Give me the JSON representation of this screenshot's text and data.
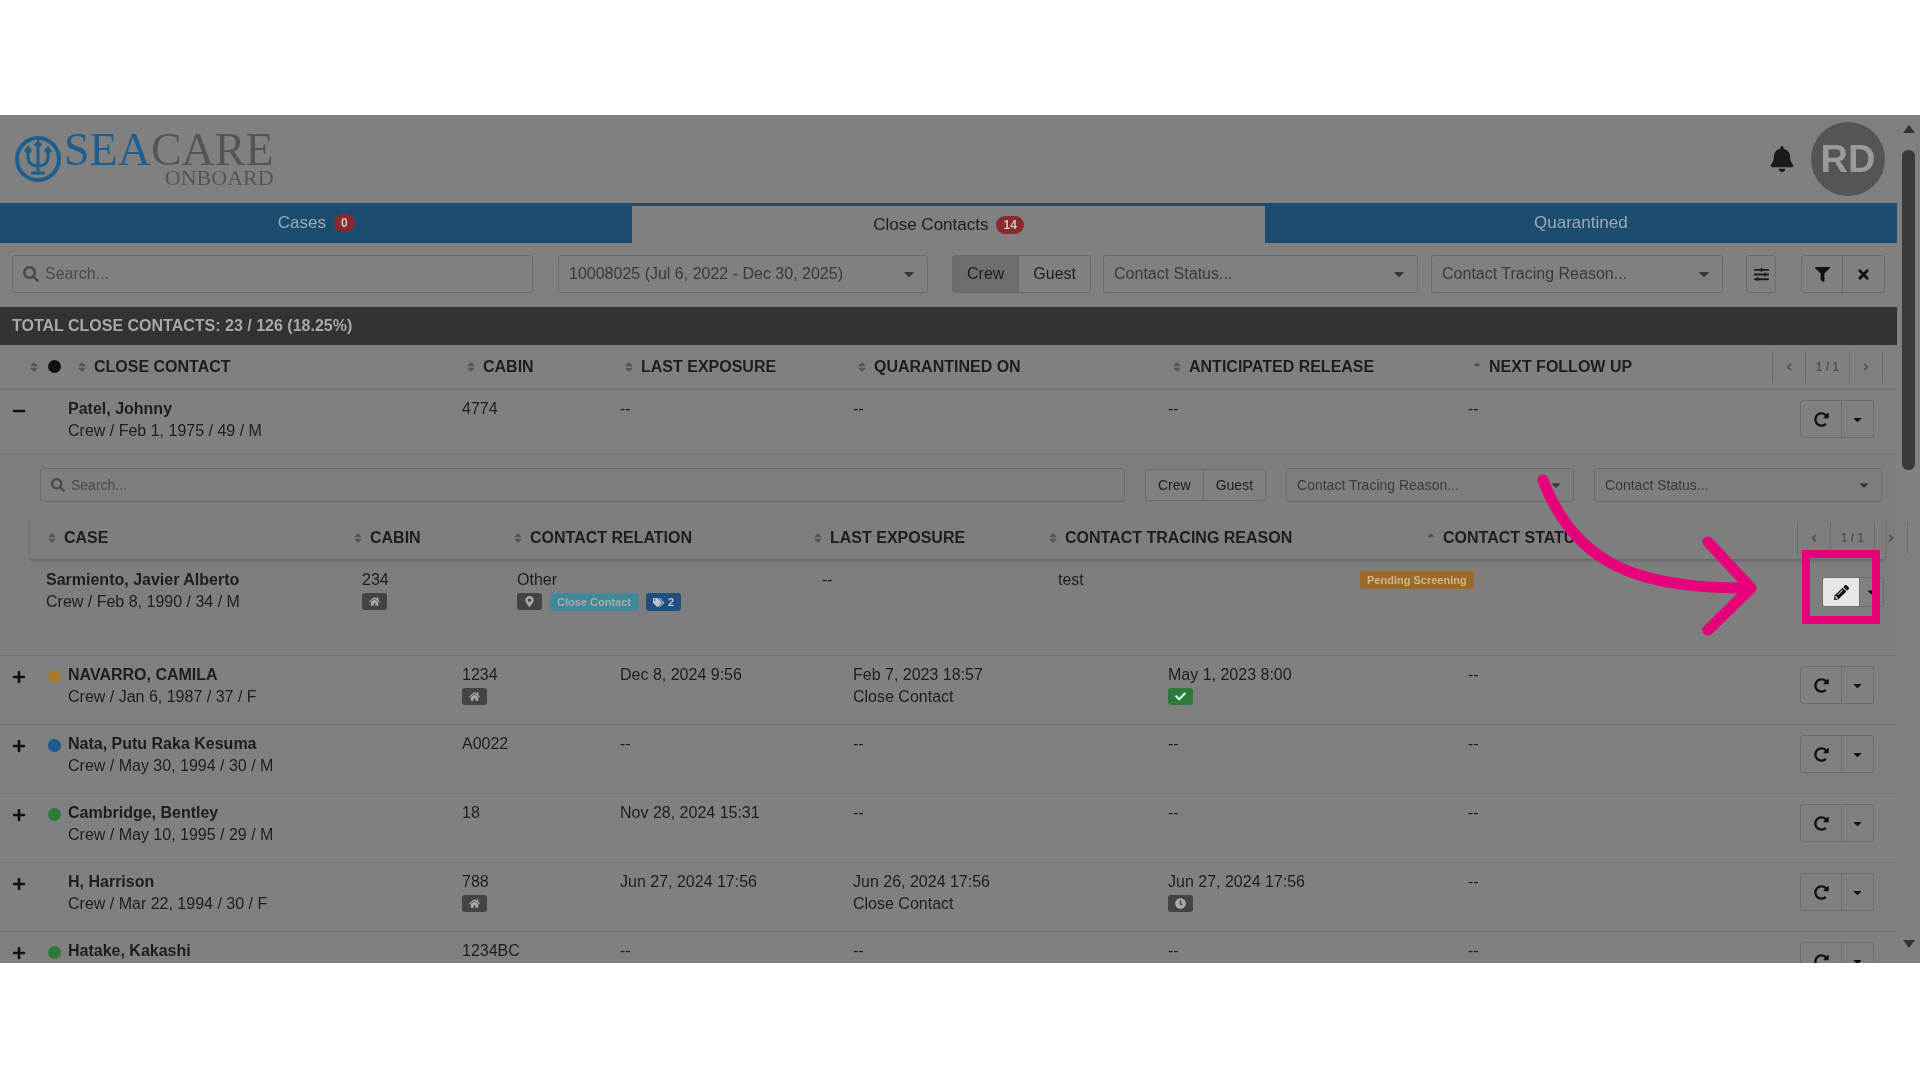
{
  "header": {
    "logo": {
      "brand_primary": "SEA",
      "brand_secondary": "CARE",
      "tagline": "ONBOARD"
    },
    "avatar_initials": "RD"
  },
  "tabs": [
    {
      "label": "Cases",
      "count": "0",
      "selected": false
    },
    {
      "label": "Close Contacts",
      "count": "14",
      "selected": true
    },
    {
      "label": "Quarantined",
      "selected": false
    }
  ],
  "filters": {
    "search": {
      "placeholder": "Search..."
    },
    "voyage": "10008025 (Jul 6, 2022 - Dec 30, 2025)",
    "type_toggle": [
      {
        "label": "Crew",
        "selected": true
      },
      {
        "label": "Guest",
        "selected": false
      }
    ],
    "contact_status": {
      "placeholder": "Contact Status..."
    },
    "contact_tracing_reason": {
      "placeholder": "Contact Tracing Reason..."
    }
  },
  "summary": "TOTAL CLOSE CONTACTS: 23 / 126 (18.25%)",
  "table": {
    "columns": [
      {
        "label": "CLOSE CONTACT",
        "sorted": false
      },
      {
        "label": "CABIN",
        "sorted": false
      },
      {
        "label": "LAST EXPOSURE",
        "sorted": false
      },
      {
        "label": "QUARANTINED ON",
        "sorted": false
      },
      {
        "label": "ANTICIPATED RELEASE",
        "sorted": false
      },
      {
        "label": "NEXT FOLLOW UP",
        "sorted": true
      }
    ],
    "pager": "1 / 1",
    "rows": [
      {
        "name": "Patel, Johnny",
        "details": "Crew / Feb 1, 1975 / 49 / M",
        "cabin": "4774",
        "cabin_home": false,
        "last_exposure": "--",
        "quarantined_on": "--",
        "anticipated_release": "--",
        "next_follow_up": "--",
        "expanded": true,
        "contacts": {
          "search": {
            "placeholder": "Search..."
          },
          "type_toggle": [
            {
              "label": "Crew",
              "selected": false
            },
            {
              "label": "Guest",
              "selected": false
            }
          ],
          "contact_tracing_reason": {
            "placeholder": "Contact Tracing Reason..."
          },
          "contact_status": {
            "placeholder": "Contact Status..."
          },
          "columns": [
            {
              "label": "CASE",
              "sorted": false
            },
            {
              "label": "CABIN",
              "sorted": false
            },
            {
              "label": "CONTACT RELATION",
              "sorted": false
            },
            {
              "label": "LAST EXPOSURE",
              "sorted": false
            },
            {
              "label": "CONTACT TRACING REASON",
              "sorted": false
            },
            {
              "label": "CONTACT STATU",
              "sorted": true
            }
          ],
          "pager": "1 / 1",
          "rows": [
            {
              "name": "Sarmiento, Javier Alberto",
              "details": "Crew / Feb 8, 1990 / 34 / M",
              "cabin": "234",
              "cabin_home": true,
              "relation": "Other",
              "tags": [
                {
                  "kind": "location"
                },
                {
                  "kind": "label",
                  "text": "Close Contact"
                },
                {
                  "kind": "count",
                  "text": "2"
                }
              ],
              "last_exposure": "--",
              "reason": "test",
              "status": "Pending Screening",
              "highlighted": true
            }
          ]
        }
      },
      {
        "name": "NAVARRO, CAMILA",
        "details": "Crew / Jan 6, 1987 / 37 / F",
        "color": "#a8782e",
        "cabin": "1234",
        "cabin_home": true,
        "last_exposure": "Dec 8, 2024 9:56",
        "quarantined_on": "Feb 7, 2023 18:57",
        "quarantine_reason": "Close Contact",
        "anticipated_release": "May 1, 2023 8:00",
        "release_confirmed": true,
        "next_follow_up": "--",
        "expanded": false
      },
      {
        "name": "Nata, Putu Raka Kesuma",
        "details": "Crew / May 30, 1994 / 30 / M",
        "color": "#1e5a8c",
        "cabin": "A0022",
        "cabin_home": false,
        "last_exposure": "--",
        "quarantined_on": "--",
        "anticipated_release": "--",
        "next_follow_up": "--",
        "expanded": false
      },
      {
        "name": "Cambridge, Bentley",
        "details": "Crew / May 10, 1995 / 29 / M",
        "color": "#2e7a3a",
        "cabin": "18",
        "cabin_home": false,
        "last_exposure": "Nov 28, 2024 15:31",
        "quarantined_on": "--",
        "anticipated_release": "--",
        "next_follow_up": "--",
        "expanded": false
      },
      {
        "name": "H, Harrison",
        "details": "Crew / Mar 22, 1994 / 30 / F",
        "cabin": "788",
        "cabin_home": true,
        "last_exposure": "Jun 27, 2024 17:56",
        "quarantined_on": "Jun 26, 2024 17:56",
        "quarantine_reason": "Close Contact",
        "anticipated_release": "Jun 27, 2024 17:56",
        "release_confirmed": false,
        "next_follow_up": "--",
        "expanded": false
      },
      {
        "name": "Hatake, Kakashi",
        "color": "#2e7a3a",
        "cabin": "1234BC",
        "cabin_home": false,
        "last_exposure": "--",
        "quarantined_on": "--",
        "anticipated_release": "--",
        "next_follow_up": "--",
        "expanded": false
      }
    ]
  }
}
